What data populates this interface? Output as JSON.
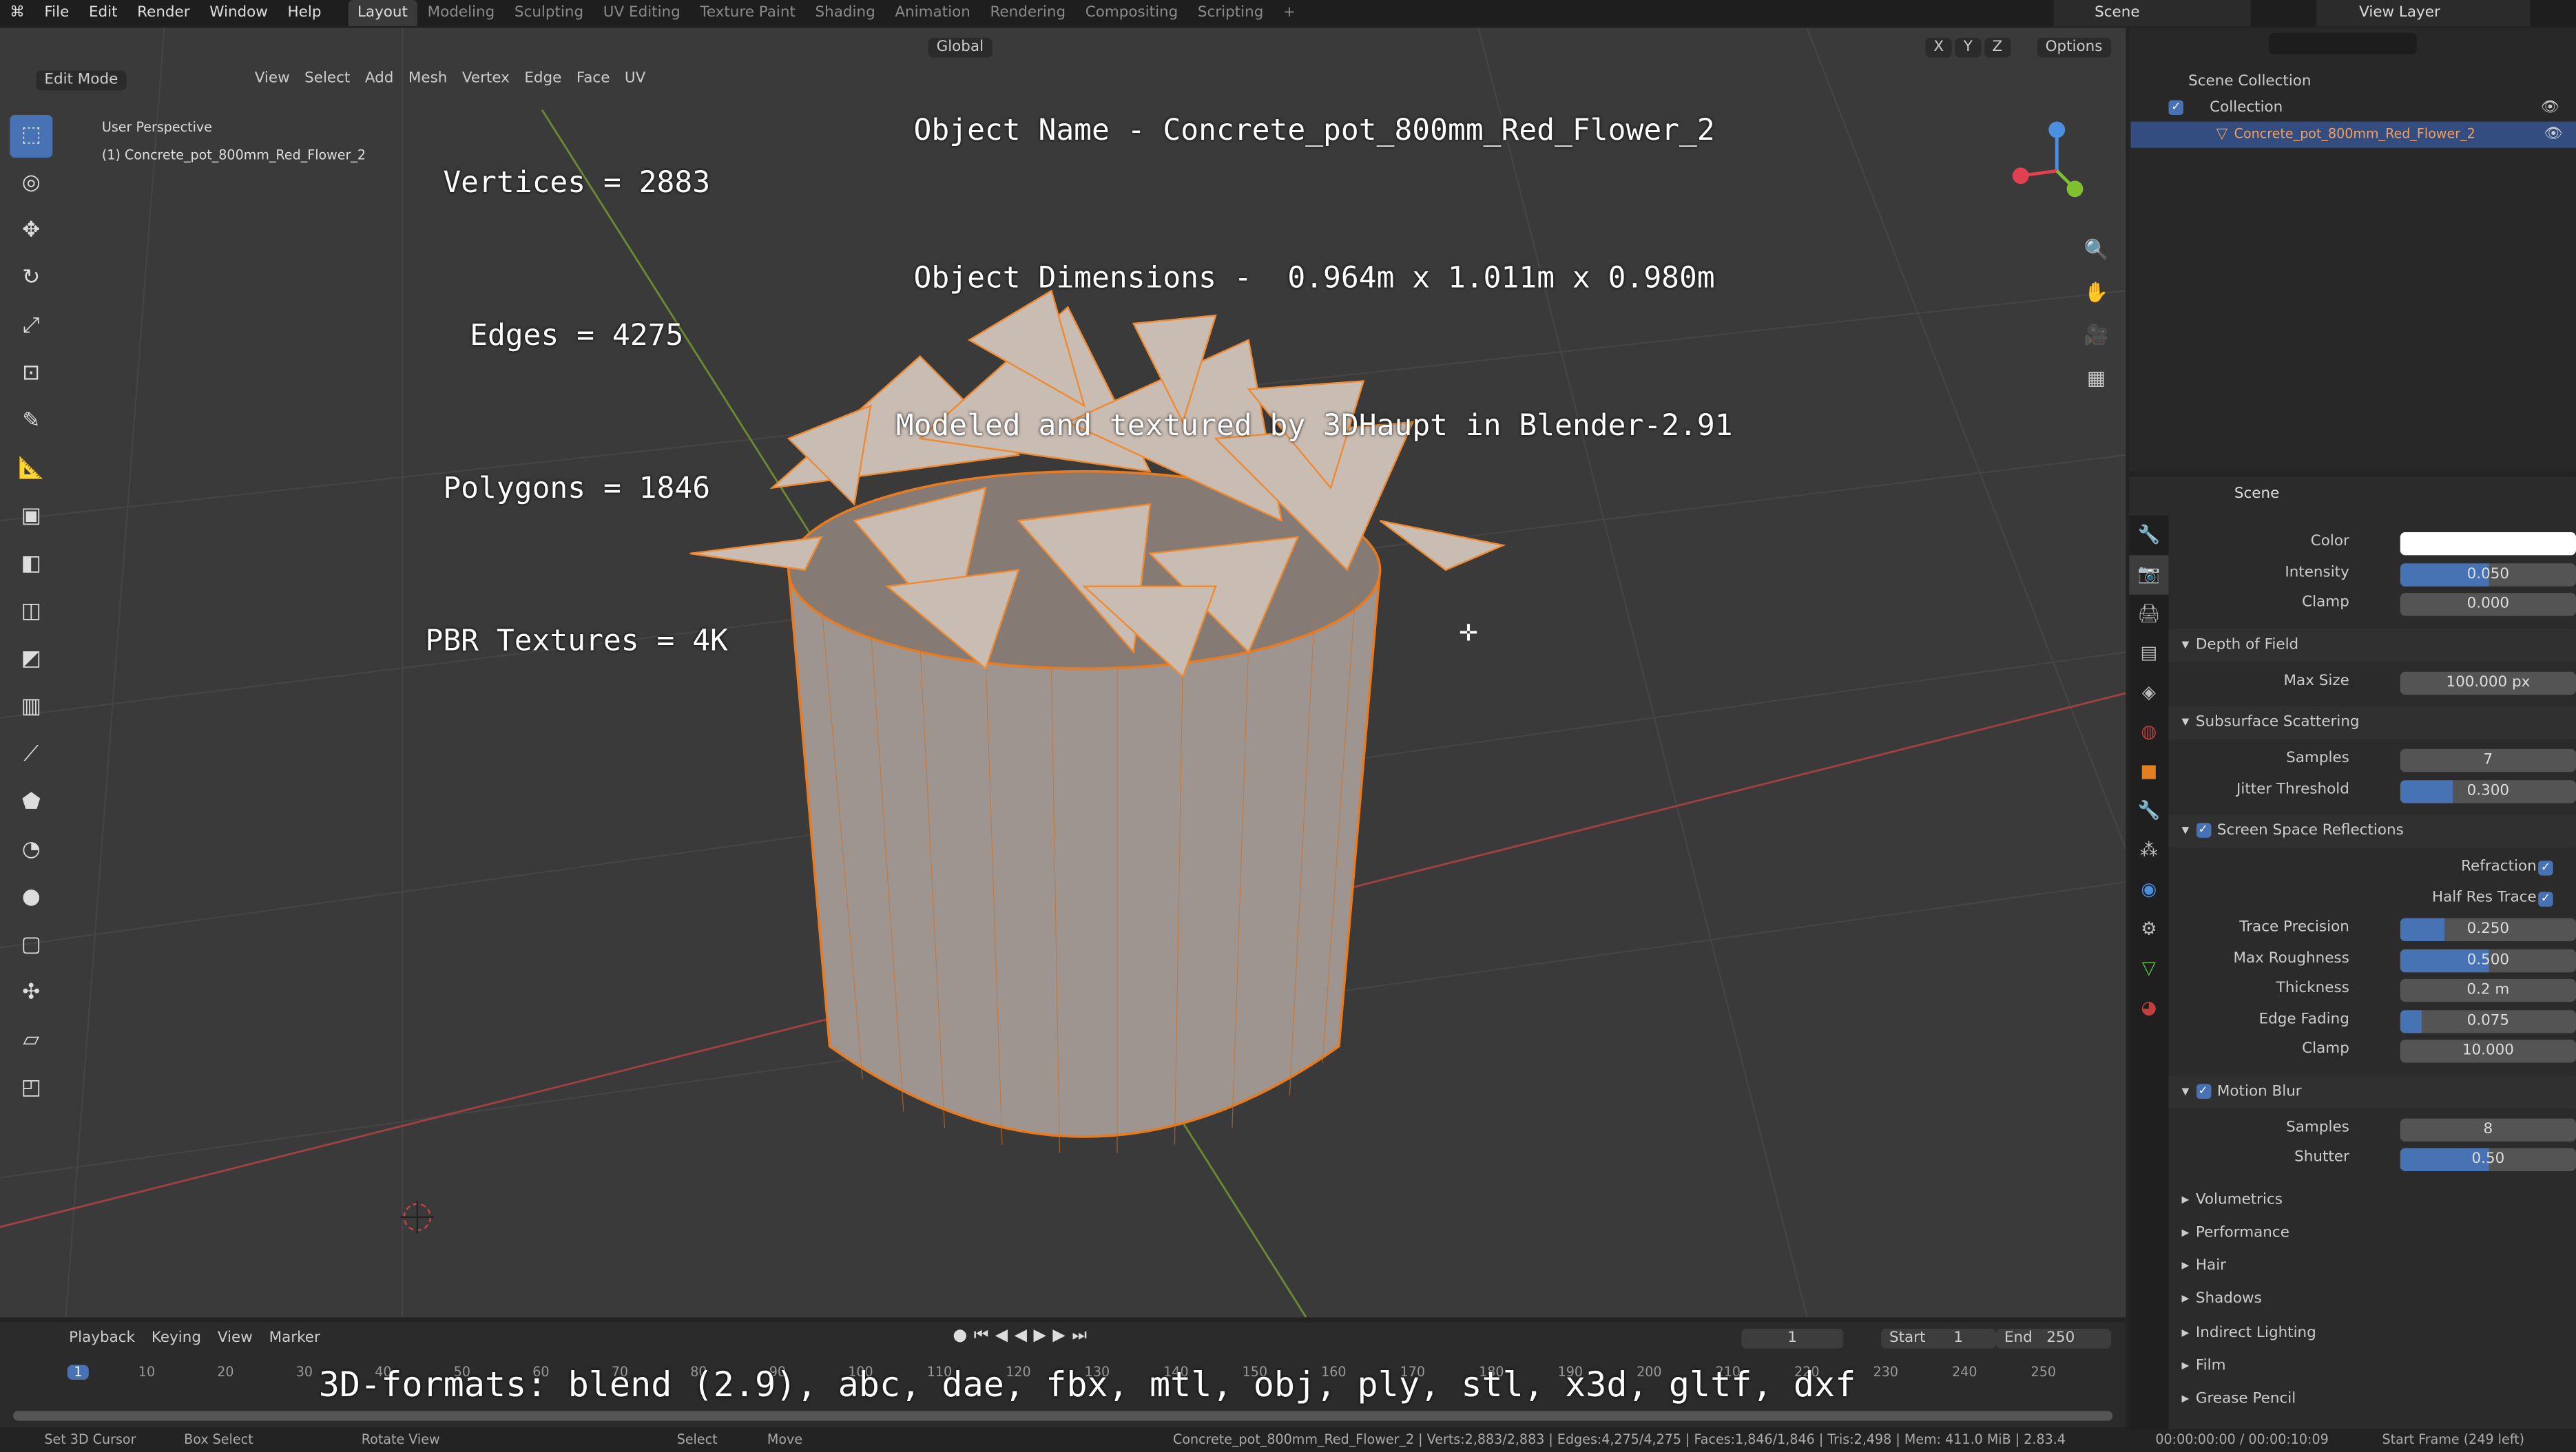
{
  "menu": [
    "File",
    "Edit",
    "Render",
    "Window",
    "Help"
  ],
  "workspaces": [
    "Layout",
    "Modeling",
    "Sculpting",
    "UV Editing",
    "Texture Paint",
    "Shading",
    "Animation",
    "Rendering",
    "Compositing",
    "Scripting",
    "+"
  ],
  "active_workspace": "Layout",
  "scene": "Scene",
  "view_layer": "View Layer",
  "viewport": {
    "mode": "Edit Mode",
    "menus": [
      "View",
      "Select",
      "Add",
      "Mesh",
      "Vertex",
      "Edge",
      "Face",
      "UV"
    ],
    "orientation": "Global",
    "options": "Options",
    "axes": [
      "X",
      "Y",
      "Z"
    ],
    "perspective": "User Perspective",
    "object_label": "(1) Concrete_pot_800mm_Red_Flower_2"
  },
  "overlay": {
    "name": "Object Name - Concrete_pot_800mm_Red_Flower_2",
    "dims": "Object Dimensions -  0.964m x 1.011m x 0.980m",
    "credit": "Modeled and textured by 3DHaupt in Blender-2.91",
    "vertices": "Vertices = 2883",
    "edges": "Edges = 4275",
    "polygons": "Polygons = 1846",
    "textures": "PBR Textures = 4K",
    "formats": "3D-formats: blend (2.9), abc, dae, fbx, mtl, obj, ply, stl, x3d, gltf, dxf"
  },
  "outliner": {
    "scene_collection": "Scene Collection",
    "collection": "Collection",
    "object": "Concrete_pot_800mm_Red_Flower_2"
  },
  "properties": {
    "context": "Scene",
    "top_rows": [
      {
        "label": "Color",
        "value": "",
        "white": true
      },
      {
        "label": "Intensity",
        "value": "0.050",
        "fill": 0.5
      },
      {
        "label": "Clamp",
        "value": "0.000"
      }
    ],
    "dof": {
      "title": "Depth of Field",
      "rows": [
        {
          "label": "Max Size",
          "value": "100.000 px"
        }
      ]
    },
    "sss": {
      "title": "Subsurface Scattering",
      "rows": [
        {
          "label": "Samples",
          "value": "7"
        },
        {
          "label": "Jitter Threshold",
          "value": "0.300",
          "fill": 0.3
        }
      ]
    },
    "ssr": {
      "title": "Screen Space Reflections",
      "checks": [
        {
          "label": "Refraction"
        },
        {
          "label": "Half Res Trace"
        }
      ],
      "rows": [
        {
          "label": "Trace Precision",
          "value": "0.250",
          "fill": 0.25
        },
        {
          "label": "Max Roughness",
          "value": "0.500",
          "fill": 0.5
        },
        {
          "label": "Thickness",
          "value": "0.2 m"
        },
        {
          "label": "Edge Fading",
          "value": "0.075",
          "fill": 0.12
        },
        {
          "label": "Clamp",
          "value": "10.000"
        }
      ]
    },
    "mb": {
      "title": "Motion Blur",
      "rows": [
        {
          "label": "Samples",
          "value": "8"
        },
        {
          "label": "Shutter",
          "value": "0.50",
          "fill": 0.5
        }
      ]
    },
    "collapsed": [
      "Volumetrics",
      "Performance",
      "Hair",
      "Shadows",
      "Indirect Lighting",
      "Film",
      "Grease Pencil"
    ]
  },
  "timeline": {
    "menus": [
      "Playback",
      "Keying",
      "View",
      "Marker"
    ],
    "current": "1",
    "start_label": "Start",
    "start": "1",
    "end_label": "End",
    "end": "250",
    "ticks": [
      "1",
      "10",
      "20",
      "30",
      "40",
      "50",
      "60",
      "70",
      "80",
      "90",
      "100",
      "110",
      "120",
      "130",
      "140",
      "150",
      "160",
      "170",
      "180",
      "190",
      "200",
      "210",
      "220",
      "230",
      "240",
      "250"
    ]
  },
  "status": {
    "items": [
      "Set 3D Cursor",
      "Box Select",
      "Rotate View",
      "Select",
      "Move"
    ],
    "stats": "Concrete_pot_800mm_Red_Flower_2 | Verts:2,883/2,883 | Edges:4,275/4,275 | Faces:1,846/1,846 | Tris:2,498 | Mem: 411.0 MiB | 2.83.4",
    "time": "00:00:00:00 / 00:00:10:09",
    "frame": "Start Frame (249 left)"
  }
}
